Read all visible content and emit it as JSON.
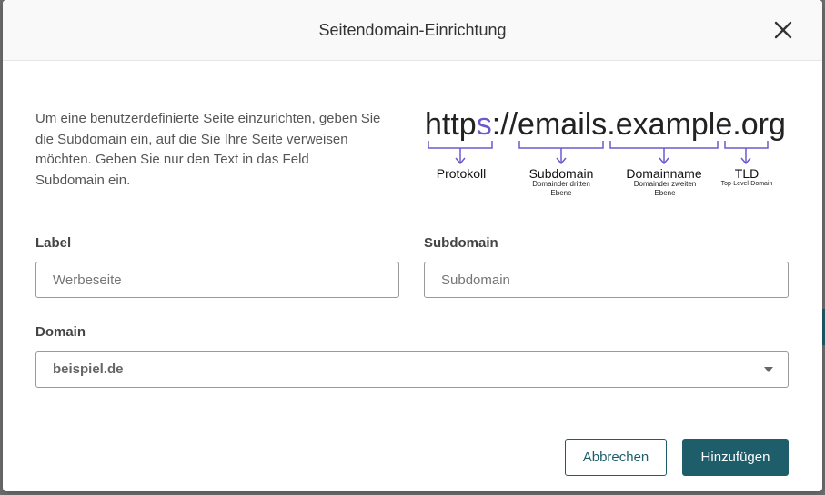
{
  "modal": {
    "title": "Seitendomain-Einrichtung",
    "intro": "Um eine benutzerdefinierte Seite einzurichten, geben Sie die Subdomain ein, auf die Sie Ihre Seite verweisen möchten. Geben Sie nur den Text in das Feld Subdomain ein."
  },
  "url_diagram": {
    "protocol_text": "http",
    "protocol_s": "s",
    "rest_text": "://emails.example.org",
    "segments": {
      "protocol": {
        "label": "Protokoll",
        "sub": ""
      },
      "subdomain": {
        "label": "Subdomain",
        "sub": "Domainder dritten Ebene"
      },
      "domainname": {
        "label": "Domainname",
        "sub": "Domainder zweiten Ebene"
      },
      "tld": {
        "label": "TLD",
        "sub": "Top-Level-Domain"
      }
    },
    "accent_color": "#6a5acd"
  },
  "form": {
    "label_field": {
      "label": "Label",
      "placeholder": "Werbeseite",
      "value": ""
    },
    "subdomain_field": {
      "label": "Subdomain",
      "placeholder": "Subdomain",
      "value": ""
    },
    "domain_field": {
      "label": "Domain",
      "selected": "beispiel.de"
    }
  },
  "footer": {
    "cancel_label": "Abbrechen",
    "add_label": "Hinzufügen"
  },
  "colors": {
    "primary": "#1e5e6b",
    "overlay": "#6f6f6f"
  }
}
